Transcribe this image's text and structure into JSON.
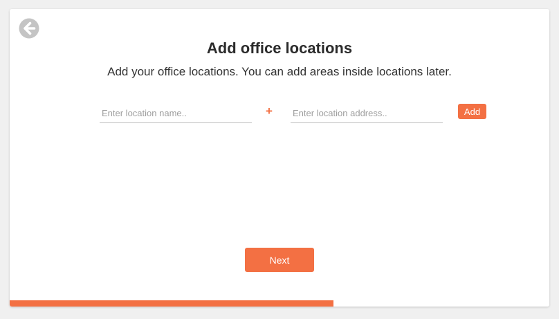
{
  "header": {
    "back_icon": "arrow-left-circle-icon",
    "title": "Add office locations",
    "subtitle": "Add your office locations. You can add areas inside locations later."
  },
  "form": {
    "location_name": {
      "value": "",
      "placeholder": "Enter location name.."
    },
    "plus_symbol": "+",
    "location_address": {
      "value": "",
      "placeholder": "Enter location address.."
    },
    "add_label": "Add"
  },
  "footer": {
    "next_label": "Next"
  },
  "progress": {
    "fraction": 0.6
  },
  "colors": {
    "accent": "#f37043",
    "back_icon": "#c4c4c4",
    "text": "#2b2b2b",
    "background": "#f0f0f0"
  }
}
